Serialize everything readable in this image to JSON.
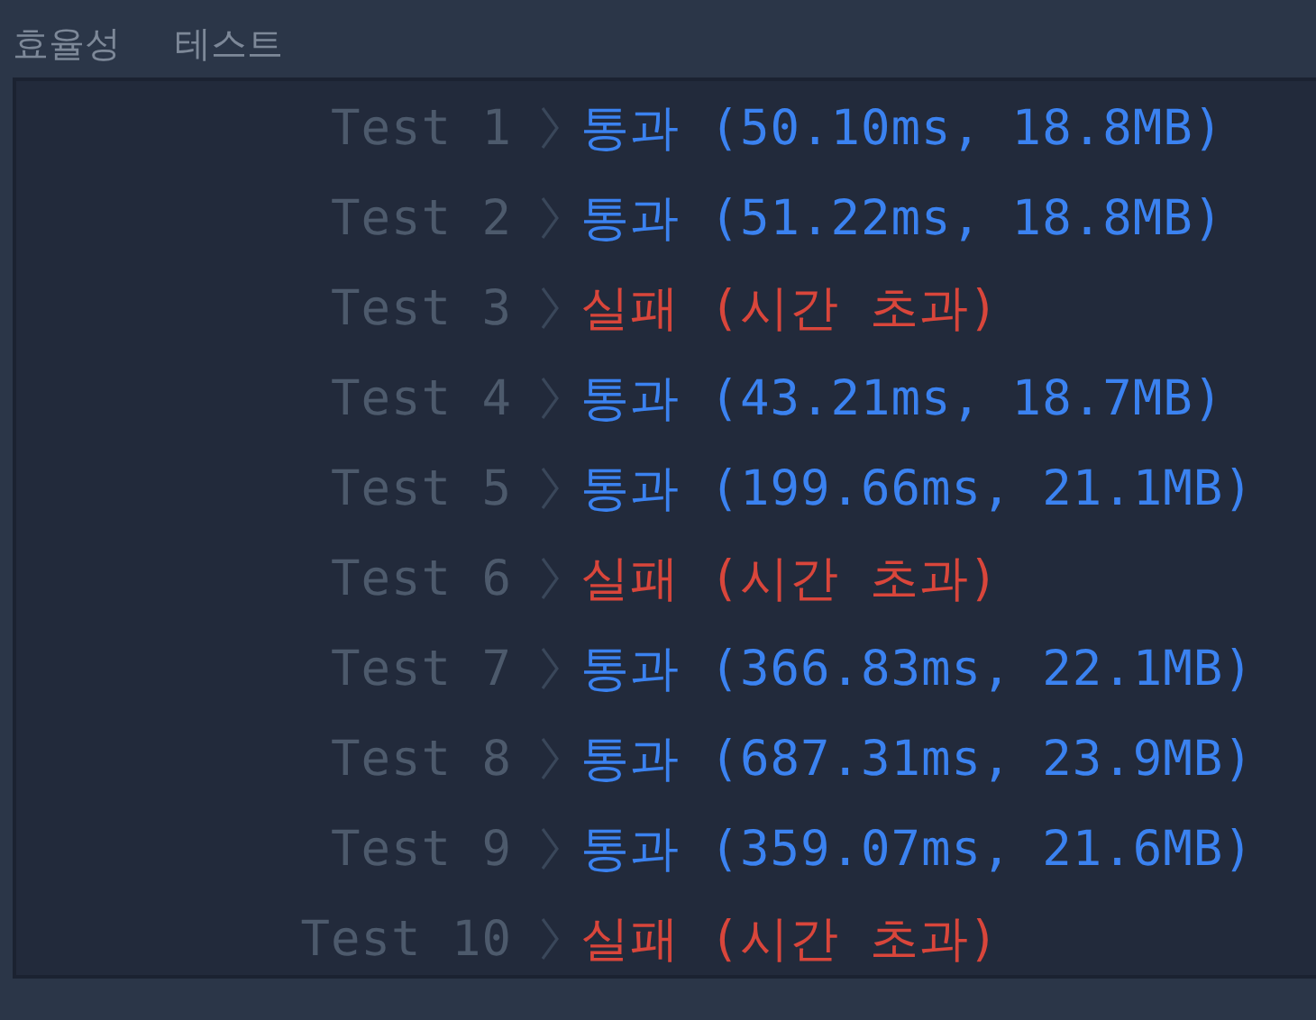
{
  "headers": [
    "효율성",
    "테스트"
  ],
  "tests": [
    {
      "label": "Test 1",
      "kind": "pass",
      "result": "통과 (50.10ms, 18.8MB)"
    },
    {
      "label": "Test 2",
      "kind": "pass",
      "result": "통과 (51.22ms, 18.8MB)"
    },
    {
      "label": "Test 3",
      "kind": "fail",
      "result": "실패 (시간 초과)"
    },
    {
      "label": "Test 4",
      "kind": "pass",
      "result": "통과 (43.21ms, 18.7MB)"
    },
    {
      "label": "Test 5",
      "kind": "pass",
      "result": "통과 (199.66ms, 21.1MB)"
    },
    {
      "label": "Test 6",
      "kind": "fail",
      "result": "실패 (시간 초과)"
    },
    {
      "label": "Test 7",
      "kind": "pass",
      "result": "통과 (366.83ms, 22.1MB)"
    },
    {
      "label": "Test 8",
      "kind": "pass",
      "result": "통과 (687.31ms, 23.9MB)"
    },
    {
      "label": "Test 9",
      "kind": "pass",
      "result": "통과 (359.07ms, 21.6MB)"
    },
    {
      "label": "Test 10",
      "kind": "fail",
      "result": "실패 (시간 초과)"
    }
  ]
}
